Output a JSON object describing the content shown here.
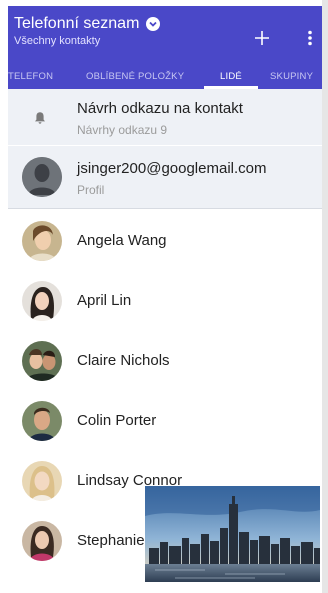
{
  "header": {
    "title": "Telefonní seznam",
    "subtitle": "Všechny kontakty",
    "add_icon": "plus-icon",
    "menu_icon": "more-vert-icon",
    "background": "#4a48c8"
  },
  "tabs": [
    {
      "label": "TELEFON",
      "active": false
    },
    {
      "label": "OBLÍBENÉ POLOŽKY",
      "active": false
    },
    {
      "label": "LIDÉ",
      "active": true
    },
    {
      "label": "SKUPINY",
      "active": false
    }
  ],
  "suggestion": {
    "icon": "bell-icon",
    "title": "Návrh odkazu na kontakt",
    "subtitle": "Návrhy odkazu 9"
  },
  "profile": {
    "email": "jsinger200@googlemail.com",
    "label": "Profil"
  },
  "contacts": [
    {
      "name": "Angela Wang"
    },
    {
      "name": "April Lin"
    },
    {
      "name": "Claire Nichols"
    },
    {
      "name": "Colin Porter"
    },
    {
      "name": "Lindsay Connor"
    },
    {
      "name": "Stephanie"
    }
  ]
}
